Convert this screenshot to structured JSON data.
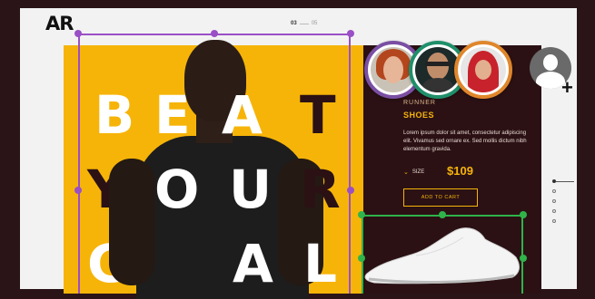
{
  "brand": {
    "logo": "AR"
  },
  "pager": {
    "current": "03",
    "total": "05"
  },
  "hero": {
    "line1": [
      "B",
      "E",
      "A",
      "T"
    ],
    "line2": [
      "Y",
      "O",
      "U",
      "R"
    ],
    "line3": [
      "G",
      "O",
      "A",
      "L"
    ]
  },
  "product": {
    "category": "RUNNER",
    "name": "SHOES",
    "description": "Lorem ipsum dolor sit amet, consectetur adipiscing elit. Vivamus sed ornare ex. Sed mollis dictum nibh elementum gravida.",
    "size_label": "SIZE",
    "price": "$109",
    "cart_label": "ADD TO CART"
  },
  "colors": {
    "accent": "#f6b409",
    "panel": "#2b1114",
    "selection_purple": "#9a4fc6",
    "selection_green": "#2fb34a"
  },
  "icons": {
    "add_user": "add-user-icon",
    "size_chevron": "chevron-down-icon"
  }
}
